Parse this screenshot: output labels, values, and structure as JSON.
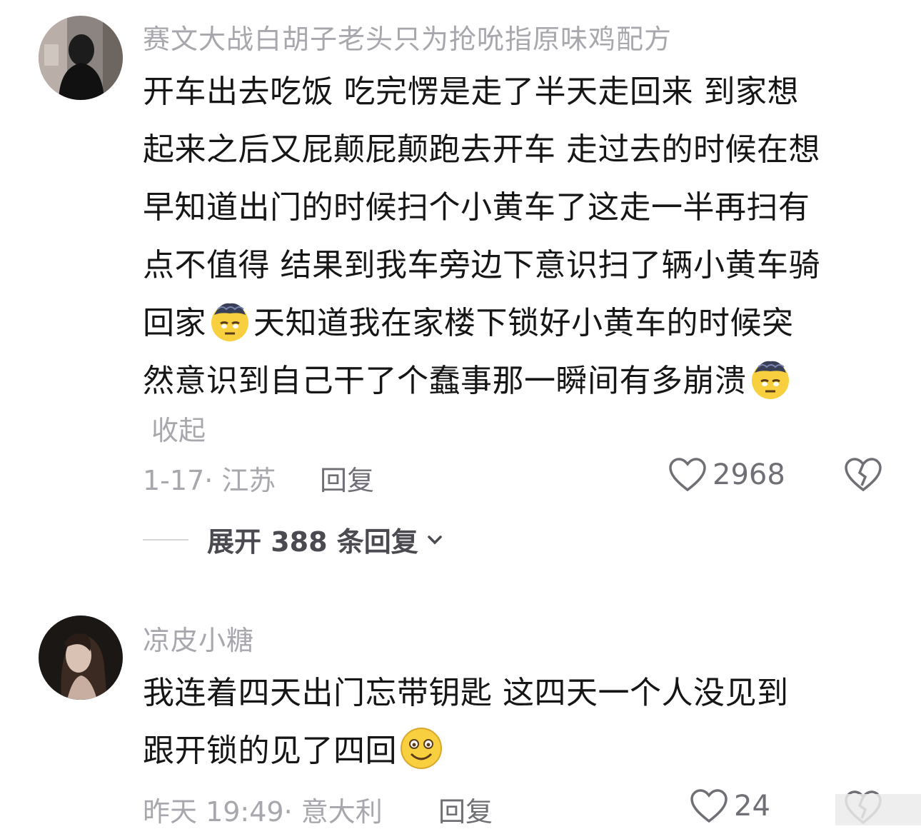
{
  "comments": [
    {
      "username": "赛文大战白胡子老头只为抢吮指原味鸡配方",
      "lines": [
        "开车出去吃饭 吃完愣是走了半天走回来 到家想",
        "起来之后又屁颠屁颠跑去开车 走过去的时候在想",
        "早知道出门的时候扫个小黄车了这走一半再扫有",
        "点不值得 结果到我车旁边下意识扫了辆小黄车骑"
      ],
      "line5_a": "回家",
      "line5_b": "天知道我在家楼下锁好小黄车的时候突",
      "line6": "然意识到自己干了个蠢事那一瞬间有多崩溃",
      "collapse_label": "收起",
      "meta": "1-17· 江苏",
      "reply_label": "回复",
      "likes": "2968",
      "expand_label": "展开 388 条回复",
      "emoji": "dizzy-face-emoji"
    },
    {
      "username": "凉皮小糖",
      "line1": "我连着四天出门忘带钥匙 这四天一个人没见到",
      "line2": "跟开锁的见了四回",
      "meta": "昨天 19:49· 意大利",
      "reply_label": "回复",
      "likes": "24",
      "emoji": "smile-face-emoji"
    }
  ],
  "colors": {
    "meta_gray": "#a7a7ad",
    "text": "#161616"
  }
}
